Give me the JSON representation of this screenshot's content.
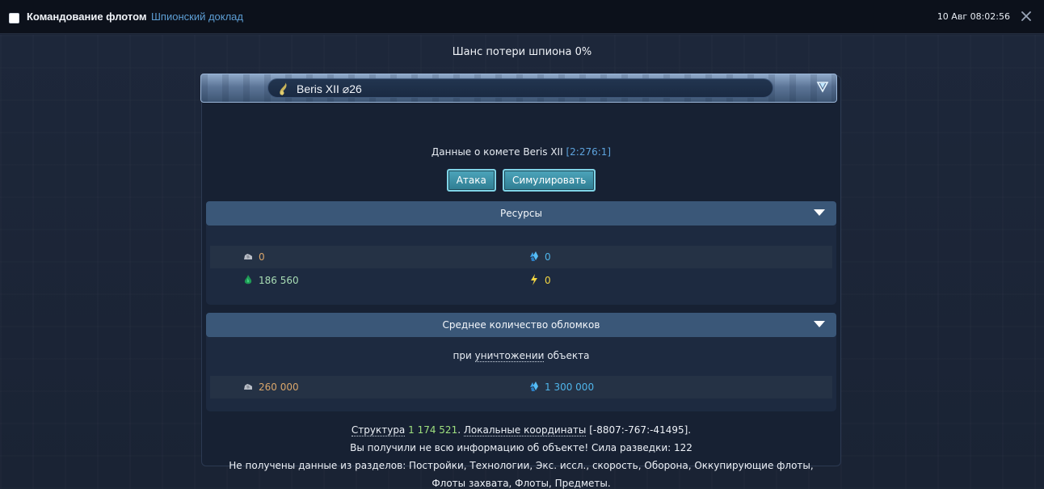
{
  "topbar": {
    "title": "Командование флотом",
    "subtitle": "Шпионский доклад",
    "date": "10 Авг 08:02:56"
  },
  "spy_chance": "Шанс потери шпиона 0%",
  "planet": {
    "name": "Beris XII ⌀26",
    "info_prefix": "Данные о комете Beris XII",
    "coords": "[2:276:1]"
  },
  "actions": {
    "attack": "Атака",
    "simulate": "Симулировать"
  },
  "resources": {
    "title": "Ресурсы",
    "metal": "0",
    "crystal": "0",
    "deuterium": "186 560",
    "energy": "0"
  },
  "debris": {
    "title": "Среднее количество обломков",
    "note_prefix": "при",
    "note_link": "уничтожении",
    "note_suffix": "объекта",
    "metal": "260 000",
    "crystal": "1 300 000"
  },
  "footer": {
    "structure_label": "Структура",
    "structure_value": "1 174 521",
    "local_coords_label": "Локальные координаты",
    "local_coords_value": "[-8807:-767:-41495].",
    "incomplete": "Вы получили не всю информацию об объекте! Сила разведки: 122",
    "missing": "Не получены данные из разделов: Постройки, Технологии, Экс. иссл., скорость, Оборона, Оккупирующие флоты, Флоты захвата, Флоты, Предметы."
  },
  "colors": {
    "metal": "#d9a66b",
    "crystal": "#4fb5ea",
    "deuterium": "#a8dcb4",
    "energy": "#f3d642",
    "structure": "#9fe17f"
  }
}
